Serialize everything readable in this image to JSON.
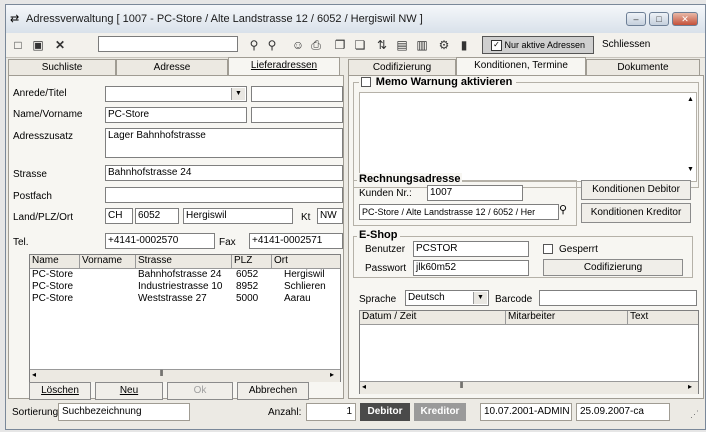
{
  "window": {
    "title": "Adressverwaltung  [ 1007 - PC-Store / Alte Landstrasse 12 / 6052 / Hergiswil NW ]",
    "controls": [
      "–",
      "□",
      "✕"
    ]
  },
  "toolbar": {
    "search_value": "",
    "active_only_label": "Nur aktive Adressen",
    "close_label": "Schliessen"
  },
  "left_tabs": [
    "Suchliste",
    "Adresse",
    "Lieferadressen"
  ],
  "right_tabs": [
    "Codifizierung",
    "Konditionen, Termine",
    "Dokumente"
  ],
  "form": {
    "anrede_label": "Anrede/Titel",
    "anrede_value": "",
    "titel_value": "",
    "name_label": "Name/Vorname",
    "name_value": "PC-Store",
    "vorname_value": "",
    "adresszusatz_label": "Adresszusatz",
    "adresszusatz_value": "Lager Bahnhofstrasse",
    "strasse_label": "Strasse",
    "strasse_value": "Bahnhofstrasse 24",
    "postfach_label": "Postfach",
    "postfach_value": "",
    "land_label": "Land/PLZ/Ort",
    "land_value": "CH",
    "plz_value": "6052",
    "ort_value": "Hergiswil",
    "kt_label": "Kt",
    "kt_value": "NW",
    "tel_label": "Tel.",
    "tel_value": "+4141-0002570",
    "fax_label": "Fax",
    "fax_value": "+4141-0002571"
  },
  "address_grid": {
    "headers": [
      "Name",
      "Vorname",
      "Strasse",
      "PLZ",
      "Ort"
    ],
    "rows": [
      [
        "PC-Store",
        "",
        "Bahnhofstrasse 24",
        "6052",
        "Hergiswil"
      ],
      [
        "PC-Store",
        "",
        "Industriestrasse 10",
        "8952",
        "Schlieren"
      ],
      [
        "PC-Store",
        "",
        "Weststrasse 27",
        "5000",
        "Aarau"
      ]
    ]
  },
  "left_buttons": {
    "delete": "Löschen",
    "new": "Neu",
    "ok": "Ok",
    "cancel": "Abbrechen"
  },
  "memo": {
    "checkbox_label": "Memo Warnung aktivieren",
    "checked": false,
    "text": ""
  },
  "billing": {
    "title": "Rechnungsadresse",
    "customer_no_label": "Kunden Nr.:",
    "customer_no": "1007",
    "address_value": "PC-Store / Alte Landstrasse 12 / 6052 / Her",
    "debitor_button": "Konditionen Debitor",
    "kreditor_button": "Konditionen Kreditor"
  },
  "eshop": {
    "title": "E-Shop",
    "user_label": "Benutzer",
    "user_value": "PCSTOR",
    "password_label": "Passwort",
    "password_value": "jlk60m52",
    "locked_label": "Gesperrt",
    "locked": false,
    "codify_button": "Codifizierung"
  },
  "language": {
    "label": "Sprache",
    "value": "Deutsch",
    "barcode_label": "Barcode",
    "barcode_value": ""
  },
  "log_grid": {
    "headers": [
      "Datum / Zeit",
      "Mitarbeiter",
      "Text"
    ]
  },
  "status": {
    "sort_label": "Sortierung:",
    "sort_value": "Suchbezeichnung",
    "count_label": "Anzahl:",
    "count_value": "1",
    "debitor_badge": "Debitor",
    "kreditor_badge": "Kreditor",
    "created": "10.07.2001-ADMIN",
    "modified": "25.09.2007-ca",
    "colors": {
      "debitor": "#4a4a4a",
      "kreditor": "#9a9a9a"
    }
  }
}
